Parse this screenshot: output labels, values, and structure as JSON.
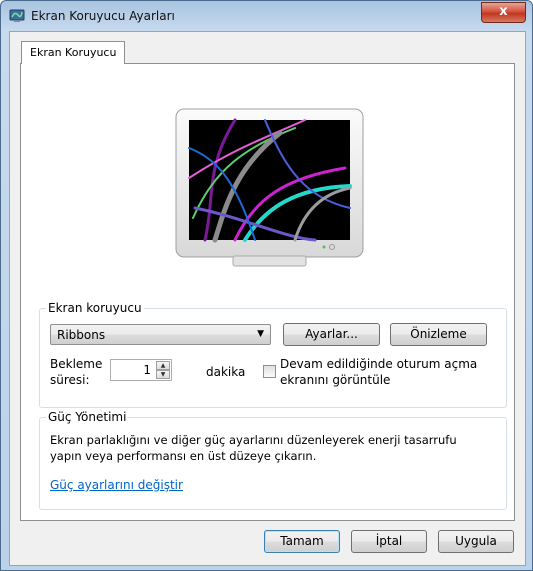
{
  "window": {
    "title": "Ekran Koruyucu Ayarları",
    "close_glyph": "x"
  },
  "tab": {
    "label": "Ekran Koruyucu"
  },
  "screensaver": {
    "group_title": "Ekran koruyucu",
    "selected": "Ribbons",
    "settings_button": "Ayarlar...",
    "preview_button": "Önizleme",
    "wait_label_1": "Bekleme",
    "wait_label_2": "süresi:",
    "wait_value": "1",
    "wait_unit": "dakika",
    "resume_label_1": "Devam edildiğinde oturum açma",
    "resume_label_2": "ekranını görüntüle",
    "resume_checked": false
  },
  "power": {
    "group_title": "Güç Yönetimi",
    "description_1": "Ekran parlaklığını ve diğer güç ayarlarını düzenleyerek enerji tasarrufu",
    "description_2": "yapın veya performansı en üst düzeye çıkarın.",
    "link": "Güç ayarlarını değiştir"
  },
  "footer": {
    "ok": "Tamam",
    "cancel": "İptal",
    "apply": "Uygula"
  },
  "icons": {
    "app": "screen-saver-app-icon",
    "close": "close-icon",
    "dropdown": "chevron-down-icon",
    "spin_up": "spin-up-icon",
    "spin_down": "spin-down-icon"
  },
  "colors": {
    "titlebar": "#bcd2ea",
    "close_button": "#c2361f",
    "link": "#0066cc",
    "default_button_border": "#3c7fb1"
  }
}
